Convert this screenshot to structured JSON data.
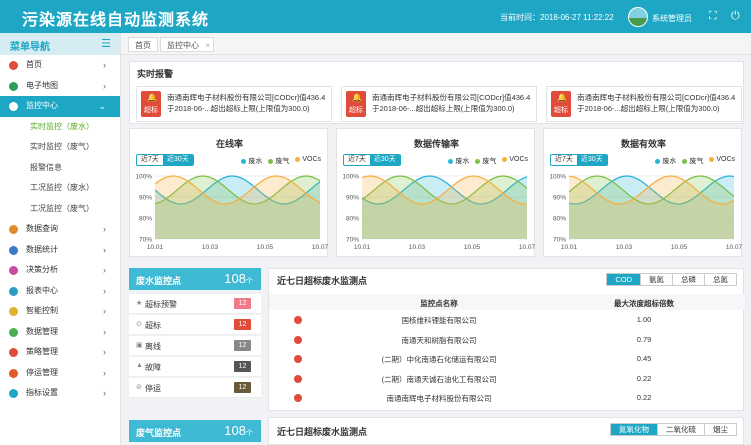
{
  "header": {
    "title": "污染源在线自动监测系统",
    "time_label": "当前时间：2018-06-27 11:22:22",
    "user": "系统管理员",
    "icons": [
      "fullscreen-icon",
      "logout-icon"
    ]
  },
  "sidebar": {
    "title": "菜单导航",
    "items": [
      {
        "label": "首页",
        "color": "#e04b3a"
      },
      {
        "label": "电子地图",
        "color": "#2c9d5a"
      },
      {
        "label": "监控中心",
        "color": "#fff",
        "active": true
      },
      {
        "label": "数据查询",
        "color": "#e08a2a"
      },
      {
        "label": "数据统计",
        "color": "#3a7ac9"
      },
      {
        "label": "决策分析",
        "color": "#c94a9e"
      },
      {
        "label": "报表中心",
        "color": "#2c9dc4"
      },
      {
        "label": "智能控制",
        "color": "#e0b12a"
      },
      {
        "label": "数据管理",
        "color": "#4caf50"
      },
      {
        "label": "策略管理",
        "color": "#e04b3a"
      },
      {
        "label": "停运管理",
        "color": "#e05a2a"
      },
      {
        "label": "指标设置",
        "color": "#1ea7c4"
      }
    ],
    "subitems": [
      "实时监控（废水）",
      "实时监控（废气）",
      "报警信息",
      "工况监控（废水）",
      "工况监控（废气）"
    ]
  },
  "tabs": {
    "home": "首页",
    "monitor": "监控中心"
  },
  "alarms": {
    "title": "实时报警",
    "badge": "超标",
    "items": [
      "南通南辉电子材料股份有限公司[CODcr]值436.4于2018-06-...超出超标上限(上限值为300.0)",
      "南通南辉电子材料股份有限公司[CODcr]值436.4于2018-06-...超出超标上限(上限值为300.0)",
      "南通南辉电子材料股份有限公司[CODcr]值436.4于2018-06-...超出超标上限(上限值为300.0)"
    ]
  },
  "charts": [
    {
      "title": "在线率",
      "t7": "近7天",
      "t30": "近30天"
    },
    {
      "title": "数据传输率",
      "t7": "近7天",
      "t30": "近30天"
    },
    {
      "title": "数据有效率",
      "t7": "近7天",
      "t30": "近30天"
    }
  ],
  "chart_data": {
    "type": "area",
    "x": [
      "10.01",
      "10.03",
      "10.05",
      "10.07"
    ],
    "ylim": [
      70,
      100
    ],
    "yticks": [
      "100%",
      "90%",
      "80%",
      "70%"
    ],
    "series": [
      {
        "name": "废水",
        "color": "#2cb5d8"
      },
      {
        "name": "废气",
        "color": "#7cc04a"
      },
      {
        "name": "VOCs",
        "color": "#f5b041"
      }
    ]
  },
  "water_stats": {
    "label": "废水监控点",
    "count": "108",
    "unit": "个",
    "rows": [
      {
        "label": "超标预警",
        "value": "12",
        "color": "#f07a8a",
        "icon": "★"
      },
      {
        "label": "超标",
        "value": "12",
        "color": "#e04b3a",
        "icon": "⊙"
      },
      {
        "label": "离线",
        "value": "12",
        "color": "#888",
        "icon": "▣"
      },
      {
        "label": "故障",
        "value": "12",
        "color": "#555",
        "icon": "▲"
      },
      {
        "label": "停运",
        "value": "12",
        "color": "#6b5a3a",
        "icon": "⊘"
      }
    ]
  },
  "gas_stats": {
    "label": "废气监控点",
    "count": "108",
    "unit": "个"
  },
  "water_table": {
    "title": "近七日超标废水监测点",
    "tabs": [
      "COD",
      "氨氮",
      "总磷",
      "总氮"
    ],
    "col_name": "监控点名称",
    "col_val": "最大浓度超标倍数",
    "rows": [
      {
        "name": "国核维科锂能有限公司",
        "val": "1.00"
      },
      {
        "name": "南通天和树脂有限公司",
        "val": "0.79"
      },
      {
        "name": "(二期）中化南通石化储运有限公司",
        "val": "0.45"
      },
      {
        "name": "(二期）南通天诚石油化工有限公司",
        "val": "0.22"
      },
      {
        "name": "南通南辉电子材料股份有限公司",
        "val": "0.22"
      }
    ]
  },
  "gas_table": {
    "title": "近七日超标废水监测点",
    "tabs": [
      "氮氧化物",
      "二氧化硫",
      "烟尘"
    ]
  }
}
